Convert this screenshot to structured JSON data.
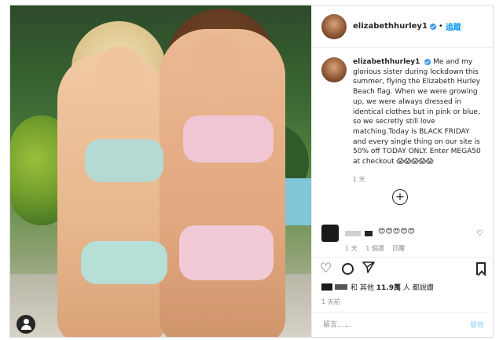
{
  "header": {
    "username": "elizabethhurley1",
    "separator": "•",
    "follow_label": "追蹤"
  },
  "caption": {
    "username": "elizabethhurley1",
    "text": "Me and my glorious sister during lockdown this summer, flying the Elizabeth Hurley Beach flag. When we were growing up, we were always dressed in identical clothes but in pink or blue, so we secretly still love matching.Today is BLACK FRIDAY and every single thing on our site is 50% off TODAY ONLY. Enter MEGA50 at checkout 😱😱😱😱😱",
    "time": "1 天"
  },
  "load_more": "+",
  "comment": {
    "text": "😍😍😍😍😍",
    "time": "1 天",
    "likes": "1 個讚",
    "reply": "回覆"
  },
  "likes_line": {
    "and_others": "和 其他",
    "count": "11.9萬",
    "suffix": "人 都說讚"
  },
  "post_time": "1 天前",
  "comment_input": {
    "placeholder": "留言……",
    "post_label": "發佈"
  },
  "icons": {
    "heart": "heart-icon",
    "comment": "comment-icon",
    "share": "share-icon",
    "bookmark": "bookmark-icon",
    "verified": "verified-badge-icon",
    "user": "user-tag-icon"
  },
  "colors": {
    "accent": "#0095f6",
    "verified": "#3897f0",
    "muted": "#8e8e8e"
  }
}
